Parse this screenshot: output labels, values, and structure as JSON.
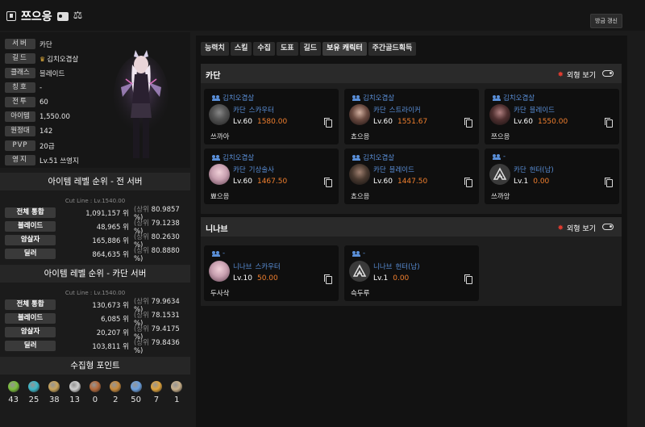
{
  "header": {
    "character_name": "쯔으응",
    "refresh_label": "방금 갱신"
  },
  "profile": {
    "rows": [
      {
        "label": "서버",
        "value": "카단"
      },
      {
        "label": "길드",
        "value": "김치오겹살"
      },
      {
        "label": "클래스",
        "value": "블레이드"
      },
      {
        "label": "칭호",
        "value": "-"
      },
      {
        "label": "전투",
        "value": "60"
      },
      {
        "label": "아이템",
        "value": "1,550.00"
      },
      {
        "label": "원정대",
        "value": "142"
      },
      {
        "label": "PVP",
        "value": "20급"
      },
      {
        "label": "영지",
        "value": "Lv.51 쓰영지"
      }
    ]
  },
  "rank_all": {
    "title": "아이템 레벨 순위 - 전 서버",
    "cutline": "Cut Line : Lv.1540.00",
    "rows": [
      {
        "label": "전체 통합",
        "rank": "1,091,157 위",
        "pct_prefix": "(상위",
        "pct": "80.9857 %)"
      },
      {
        "label": "블레이드",
        "rank": "48,965 위",
        "pct_prefix": "(상위",
        "pct": "79.1238 %)"
      },
      {
        "label": "암살자",
        "rank": "165,886 위",
        "pct_prefix": "(상위",
        "pct": "80.2630 %)"
      },
      {
        "label": "딜러",
        "rank": "864,635 위",
        "pct_prefix": "(상위",
        "pct": "80.8880 %)"
      }
    ]
  },
  "rank_server": {
    "title": "아이템 레벨 순위 - 카단 서버",
    "cutline": "Cut Line : Lv.1540.00",
    "rows": [
      {
        "label": "전체 통합",
        "rank": "130,673 위",
        "pct_prefix": "(상위",
        "pct": "79.9634 %)"
      },
      {
        "label": "블레이드",
        "rank": "6,085 위",
        "pct_prefix": "(상위",
        "pct": "78.1531 %)"
      },
      {
        "label": "암살자",
        "rank": "20,207 위",
        "pct_prefix": "(상위",
        "pct": "79.4175 %)"
      },
      {
        "label": "딜러",
        "rank": "103,811 위",
        "pct_prefix": "(상위",
        "pct": "79.8436 %)"
      }
    ]
  },
  "collect": {
    "title": "수집형 포인트",
    "items": [
      {
        "icon": "mokoko-seed-icon",
        "count": "43",
        "color": "#7bbf3a"
      },
      {
        "icon": "island-heart-icon",
        "count": "25",
        "color": "#3bb8c9"
      },
      {
        "icon": "masterpiece-icon",
        "count": "38",
        "color": "#c9a45a"
      },
      {
        "icon": "giant-heart-icon",
        "count": "13",
        "color": "#cfcfcf"
      },
      {
        "icon": "ignea-token-icon",
        "count": "0",
        "color": "#b5693a"
      },
      {
        "icon": "voyage-icon",
        "count": "2",
        "color": "#c98a3a"
      },
      {
        "icon": "world-tree-leaf-icon",
        "count": "50",
        "color": "#6aa0e0"
      },
      {
        "icon": "orpheus-star-icon",
        "count": "7",
        "color": "#e0a33a"
      },
      {
        "icon": "orgel-icon",
        "count": "1",
        "color": "#c9b08a"
      }
    ]
  },
  "tabs": [
    "능력치",
    "스킬",
    "수집",
    "도표",
    "길드",
    "보유 캐릭터",
    "주간골드획득"
  ],
  "active_tab": 5,
  "servers": [
    {
      "name": "카단",
      "look_label": "외형 보기",
      "cards": [
        {
          "guild": "김치오겹살",
          "server": "카단",
          "cls": "스카우터",
          "lv": "Lv.60",
          "il": "1580.00",
          "name": "쓰까아"
        },
        {
          "guild": "김치오겹살",
          "server": "카단",
          "cls": "스트라이커",
          "lv": "Lv.60",
          "il": "1551.67",
          "name": "쵸으응"
        },
        {
          "guild": "김치오겹살",
          "server": "카단",
          "cls": "블레이드",
          "lv": "Lv.60",
          "il": "1550.00",
          "name": "쯔으응"
        },
        {
          "guild": "김치오겹살",
          "server": "카단",
          "cls": "기상술사",
          "lv": "Lv.60",
          "il": "1467.50",
          "name": "뾰으응"
        },
        {
          "guild": "김치오겹살",
          "server": "카단",
          "cls": "블레이드",
          "lv": "Lv.60",
          "il": "1447.50",
          "name": "쵸으응"
        },
        {
          "guild": "-",
          "server": "카단",
          "cls": "헌터(남)",
          "lv": "Lv.1",
          "il": "0.00",
          "name": "쓰까앙"
        }
      ]
    },
    {
      "name": "니나브",
      "look_label": "외형 보기",
      "cards": [
        {
          "guild": "-",
          "server": "니나브",
          "cls": "스카우터",
          "lv": "Lv.10",
          "il": "50.00",
          "name": "두사삭"
        },
        {
          "guild": "-",
          "server": "니나브",
          "cls": "헌터(남)",
          "lv": "Lv.1",
          "il": "0.00",
          "name": "슥두루"
        }
      ]
    }
  ]
}
